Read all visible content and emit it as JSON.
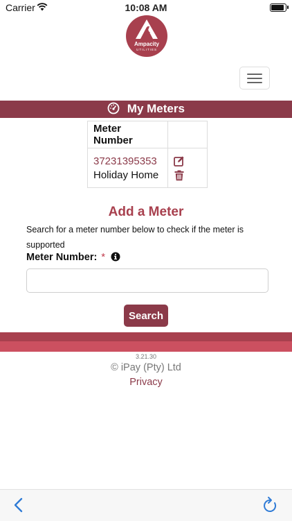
{
  "status_bar": {
    "carrier": "Carrier",
    "time": "10:08 AM"
  },
  "brand": {
    "name": "Ampacity",
    "sub": "UTILITIES",
    "color": "#a8404e"
  },
  "my_meters": {
    "title": "My Meters",
    "icon": "gauge-icon",
    "table": {
      "headers": [
        "Meter Number",
        ""
      ],
      "rows": [
        {
          "number": "37231395353",
          "name": "Holiday Home",
          "actions": [
            "edit-icon",
            "trash-icon"
          ]
        }
      ]
    }
  },
  "add_meter": {
    "title": "Add a Meter",
    "description": "Search for a meter number below to check if the meter is supported",
    "field_label": "Meter Number:",
    "required_mark": "*",
    "input_value": "",
    "search_label": "Search"
  },
  "footer": {
    "version": "3.21.30",
    "copyright": "© iPay (Pty) Ltd",
    "privacy": "Privacy"
  },
  "colors": {
    "primary": "#8b3a49",
    "accent": "#a8404e",
    "accent_light": "#cc5060",
    "ios_blue": "#2f7bd6"
  }
}
